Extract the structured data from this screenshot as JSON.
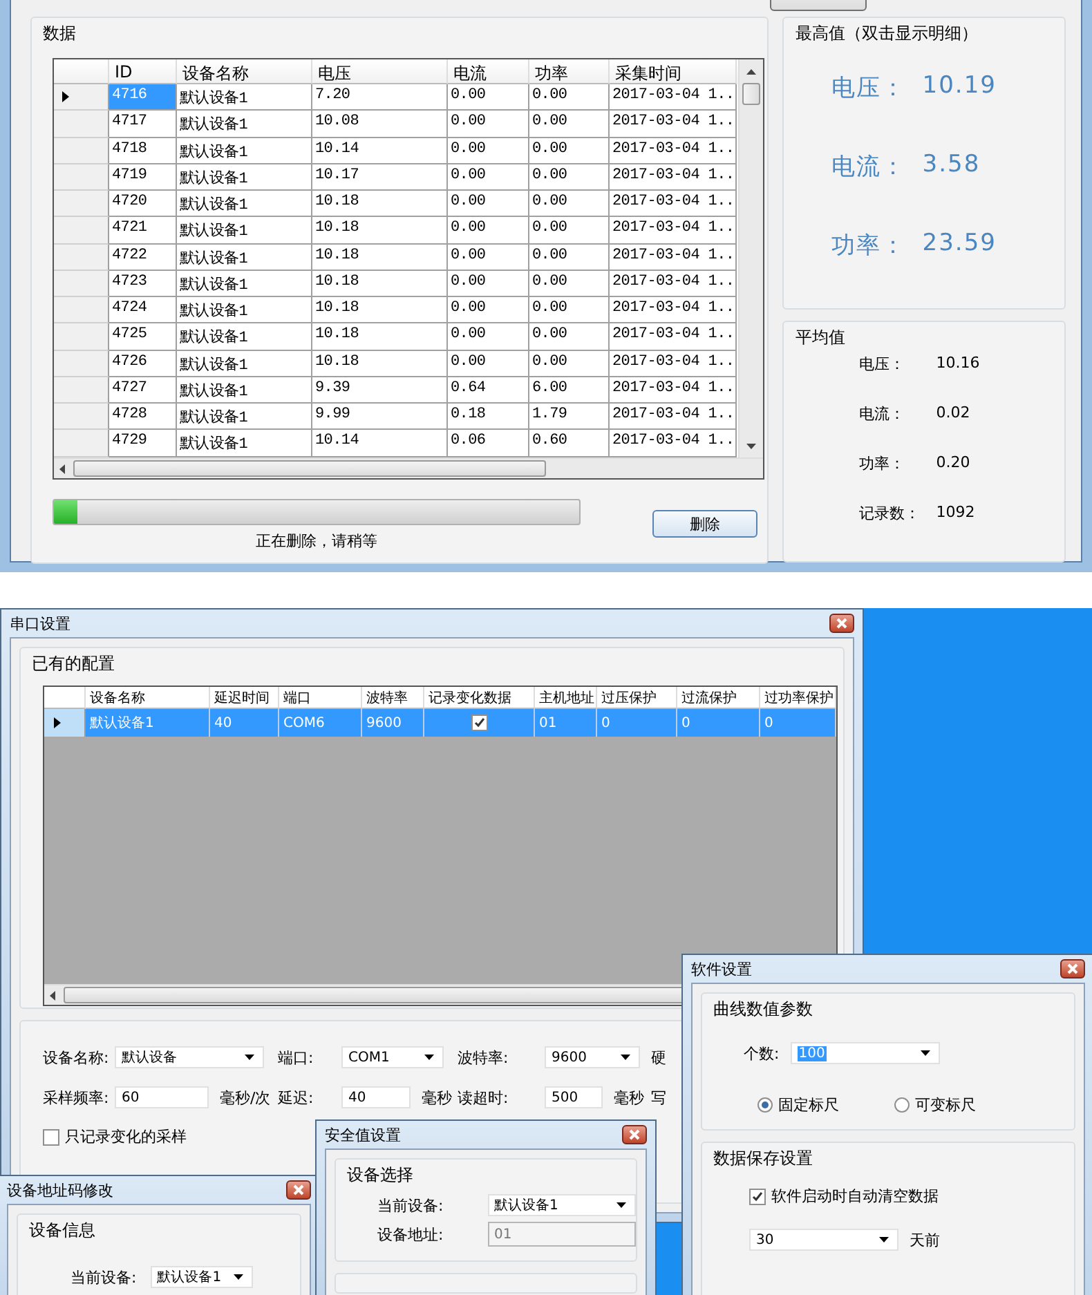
{
  "data_panel": {
    "title": "数据",
    "columns": [
      "ID",
      "设备名称",
      "电压",
      "电流",
      "功率",
      "采集时间"
    ],
    "rows": [
      {
        "selected": true,
        "cells": [
          "4716",
          "默认设备1",
          "7.20",
          "0.00",
          "0.00",
          "2017-03-04 1.."
        ]
      },
      {
        "selected": false,
        "cells": [
          "4717",
          "默认设备1",
          "10.08",
          "0.00",
          "0.00",
          "2017-03-04 1.."
        ]
      },
      {
        "selected": false,
        "cells": [
          "4718",
          "默认设备1",
          "10.14",
          "0.00",
          "0.00",
          "2017-03-04 1.."
        ]
      },
      {
        "selected": false,
        "cells": [
          "4719",
          "默认设备1",
          "10.17",
          "0.00",
          "0.00",
          "2017-03-04 1.."
        ]
      },
      {
        "selected": false,
        "cells": [
          "4720",
          "默认设备1",
          "10.18",
          "0.00",
          "0.00",
          "2017-03-04 1.."
        ]
      },
      {
        "selected": false,
        "cells": [
          "4721",
          "默认设备1",
          "10.18",
          "0.00",
          "0.00",
          "2017-03-04 1.."
        ]
      },
      {
        "selected": false,
        "cells": [
          "4722",
          "默认设备1",
          "10.18",
          "0.00",
          "0.00",
          "2017-03-04 1.."
        ]
      },
      {
        "selected": false,
        "cells": [
          "4723",
          "默认设备1",
          "10.18",
          "0.00",
          "0.00",
          "2017-03-04 1.."
        ]
      },
      {
        "selected": false,
        "cells": [
          "4724",
          "默认设备1",
          "10.18",
          "0.00",
          "0.00",
          "2017-03-04 1.."
        ]
      },
      {
        "selected": false,
        "cells": [
          "4725",
          "默认设备1",
          "10.18",
          "0.00",
          "0.00",
          "2017-03-04 1.."
        ]
      },
      {
        "selected": false,
        "cells": [
          "4726",
          "默认设备1",
          "10.18",
          "0.00",
          "0.00",
          "2017-03-04 1.."
        ]
      },
      {
        "selected": false,
        "cells": [
          "4727",
          "默认设备1",
          "9.39",
          "0.64",
          "6.00",
          "2017-03-04 1.."
        ]
      },
      {
        "selected": false,
        "cells": [
          "4728",
          "默认设备1",
          "9.99",
          "0.18",
          "1.79",
          "2017-03-04 1.."
        ]
      },
      {
        "selected": false,
        "cells": [
          "4729",
          "默认设备1",
          "10.14",
          "0.06",
          "0.60",
          "2017-03-04 1.."
        ]
      }
    ],
    "progress": {
      "level": 0.045,
      "caption": "正在删除，请稍等"
    },
    "delete_button": "删除"
  },
  "max_panel": {
    "title": "最高值（双击显示明细）",
    "items": [
      {
        "label": "电压：",
        "value": "10.19"
      },
      {
        "label": "电流：",
        "value": "3.58"
      },
      {
        "label": "功率：",
        "value": "23.59"
      }
    ]
  },
  "avg_panel": {
    "title": "平均值",
    "items": [
      {
        "label": "电压：",
        "value": "10.16"
      },
      {
        "label": "电流：",
        "value": "0.02"
      },
      {
        "label": "功率：",
        "value": "0.20"
      },
      {
        "label": "记录数：",
        "value": "1092"
      }
    ]
  },
  "serial_window": {
    "title": "串口设置",
    "group_title": "已有的配置",
    "columns": [
      {
        "label": "设备名称",
        "kind": "text"
      },
      {
        "label": "延迟时间",
        "kind": "text"
      },
      {
        "label": "端口",
        "kind": "text"
      },
      {
        "label": "波特率",
        "kind": "text"
      },
      {
        "label": "记录变化数据",
        "kind": "check"
      },
      {
        "label": "主机地址",
        "kind": "text"
      },
      {
        "label": "过压保护",
        "kind": "text"
      },
      {
        "label": "过流保护",
        "kind": "text"
      },
      {
        "label": "过功率保护",
        "kind": "text"
      }
    ],
    "rows": [
      {
        "selected": true,
        "cells": [
          {
            "text": "默认设备1"
          },
          {
            "text": "40"
          },
          {
            "text": "COM6"
          },
          {
            "text": "9600"
          },
          {
            "checked": true
          },
          {
            "text": "01"
          },
          {
            "text": "0"
          },
          {
            "text": "0"
          },
          {
            "text": "0"
          }
        ]
      }
    ],
    "form_rows": [
      [
        {
          "kind": "label",
          "text": "设备名称:"
        },
        {
          "kind": "combo",
          "value": "默认设备"
        },
        {
          "kind": "label",
          "text": "端口:"
        },
        {
          "kind": "combo",
          "value": "COM1"
        },
        {
          "kind": "label",
          "text": "波特率:"
        },
        {
          "kind": "combo",
          "value": "9600"
        },
        {
          "kind": "label",
          "text": "硬"
        }
      ],
      [
        {
          "kind": "label",
          "text": "采样频率:"
        },
        {
          "kind": "field",
          "value": "60",
          "unit": "毫秒/次"
        },
        {
          "kind": "label",
          "text": "延迟:"
        },
        {
          "kind": "field",
          "value": "40",
          "unit": "毫秒"
        },
        {
          "kind": "label",
          "text": "读超时:"
        },
        {
          "kind": "field",
          "value": "500",
          "unit": "毫秒"
        },
        {
          "kind": "label",
          "text": "写"
        }
      ]
    ],
    "only_changes": {
      "label": "只记录变化的采样",
      "checked": false
    }
  },
  "software_window": {
    "title": "软件设置",
    "curve_group": {
      "title": "曲线数值参数",
      "count_label": "个数:",
      "count_value": "100",
      "radios": [
        {
          "label": "固定标尺",
          "selected": true
        },
        {
          "label": "可变标尺",
          "selected": false
        }
      ]
    },
    "save_group": {
      "title": "数据保存设置",
      "auto_clear": {
        "label": "软件启动时自动清空数据",
        "checked": true
      },
      "days_value": "30",
      "days_unit": "天前"
    }
  },
  "address_window": {
    "title": "设备地址码修改",
    "group_title": "设备信息",
    "current_label": "当前设备:",
    "current_value": "默认设备1"
  },
  "safety_window": {
    "title": "安全值设置",
    "group_title": "设备选择",
    "current_label": "当前设备:",
    "current_value": "默认设备1",
    "address_label": "设备地址:",
    "address_value": "01"
  }
}
